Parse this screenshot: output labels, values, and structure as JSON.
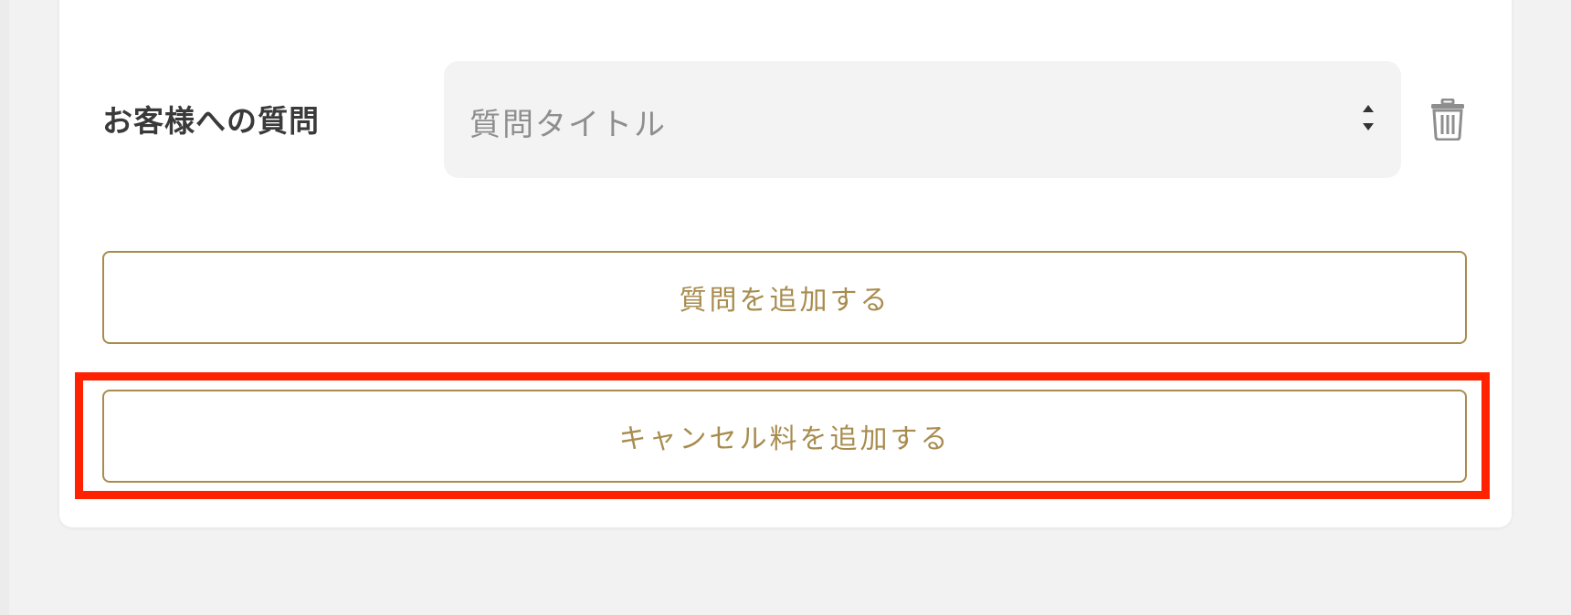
{
  "question_section": {
    "label": "お客様への質問",
    "select": {
      "value": "質問タイトル"
    },
    "delete_icon": "trash-icon"
  },
  "buttons": {
    "add_question_label": "質問を追加する",
    "add_cancel_fee_label": "キャンセル料を追加する"
  },
  "colors": {
    "accent": "#a88c4e",
    "highlight": "#ff2200",
    "label_text": "#3a3a3a",
    "placeholder_text": "#8e8e8e"
  }
}
